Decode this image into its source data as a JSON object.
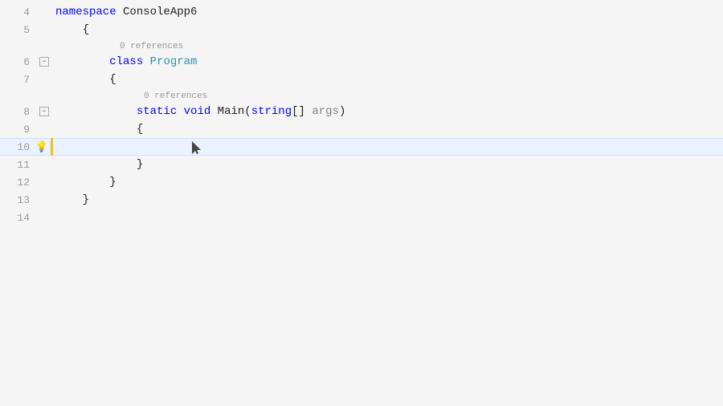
{
  "editor": {
    "background": "#f5f5f5",
    "lines": [
      {
        "number": "4",
        "indent": 0,
        "hasCollapse": false,
        "collapseOpen": false,
        "content": "namespace ConsoleApp6",
        "type": "namespace-line",
        "parts": [
          {
            "text": "namespace ",
            "class": "kw-blue"
          },
          {
            "text": "ConsoleApp6",
            "class": "plain"
          }
        ]
      },
      {
        "number": "5",
        "indent": 1,
        "hasCollapse": false,
        "content": "{",
        "type": "brace"
      },
      {
        "number": "6",
        "indent": 1,
        "hasCollapse": true,
        "collapseOpen": true,
        "hasRef": true,
        "refText": "0 references",
        "content": "class Program",
        "type": "class-line"
      },
      {
        "number": "7",
        "indent": 2,
        "hasCollapse": false,
        "content": "{",
        "type": "brace"
      },
      {
        "number": "8",
        "indent": 2,
        "hasCollapse": true,
        "collapseOpen": true,
        "hasRef": true,
        "refText": "0 references",
        "content": "static void Main(string[] args)",
        "type": "method-line"
      },
      {
        "number": "9",
        "indent": 3,
        "hasCollapse": false,
        "content": "{",
        "type": "brace"
      },
      {
        "number": "10",
        "indent": 3,
        "hasCollapse": false,
        "content": "",
        "type": "current-line",
        "isCurrent": true
      },
      {
        "number": "11",
        "indent": 3,
        "hasCollapse": false,
        "content": "}",
        "type": "brace"
      },
      {
        "number": "12",
        "indent": 2,
        "hasCollapse": false,
        "content": "}",
        "type": "brace"
      },
      {
        "number": "13",
        "indent": 1,
        "hasCollapse": false,
        "content": "}",
        "type": "brace"
      },
      {
        "number": "14",
        "indent": 0,
        "hasCollapse": false,
        "content": "",
        "type": "empty"
      }
    ]
  }
}
